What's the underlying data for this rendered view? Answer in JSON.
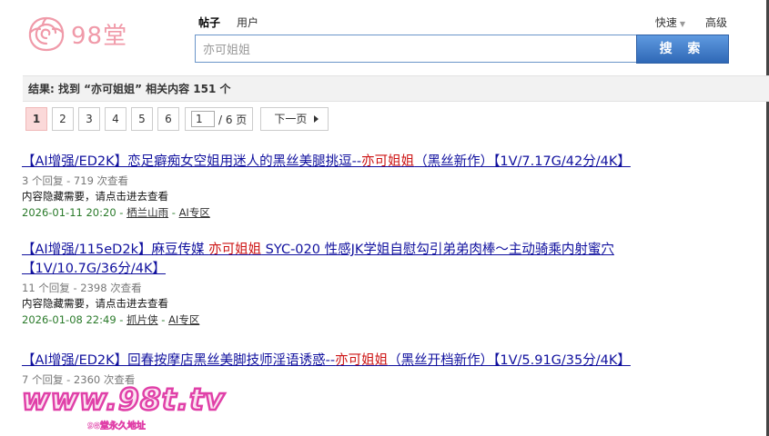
{
  "logo": {
    "text": "98堂"
  },
  "search": {
    "types": [
      "帖子",
      "用户"
    ],
    "active_type": "帖子",
    "query": "亦可姐姐",
    "button_label": "搜 索",
    "quick_label": "快速",
    "advanced_label": "高级"
  },
  "results_summary": {
    "prefix": "结果: 找到 “",
    "keyword": "亦可姐姐",
    "suffix": "” 相关内容 151 个"
  },
  "pager": {
    "pages": [
      "1",
      "2",
      "3",
      "4",
      "5",
      "6"
    ],
    "current": "1",
    "input_value": "1",
    "total_label": "/ 6 页",
    "next_label": "下一页"
  },
  "results": [
    {
      "title_before": "【AI增强/ED2K】恋足癖痴女空姐用迷人的黑丝美腿挑逗--",
      "title_hl": "亦可姐姐",
      "title_after": "（黑丝新作）【1V/7.17G/42分/4K】",
      "stats": "3 个回复 - 719 次查看",
      "snippet": "内容隐藏需要，请点击进去查看",
      "date": "2026-01-11 20:20 - ",
      "author": "栖兰山雨",
      "sep": " - ",
      "forum": "AI专区"
    },
    {
      "title_before": "【AI增强/115eD2k】麻豆传媒 ",
      "title_hl": "亦可姐姐",
      "title_after": " SYC-020 性感JK学姐自慰勾引弟弟肉棒～主动骑乘内射蜜穴【1V/10.7G/36分/4K】",
      "stats": "11 个回复 - 2398 次查看",
      "snippet": "内容隐藏需要，请点击进去查看",
      "date": "2026-01-08 22:49 - ",
      "author": "抓片侠",
      "sep": " - ",
      "forum": "AI专区"
    },
    {
      "title_before": "【AI增强/ED2K】回春按摩店黑丝美脚技师淫语诱惑--",
      "title_hl": "亦可姐姐",
      "title_after": "（黑丝开档新作）【1V/5.91G/35分/4K】",
      "stats": "7 个回复 - 2360 次查看",
      "snippet": "",
      "date": "",
      "author": "",
      "sep": "",
      "forum": ""
    }
  ],
  "watermark": {
    "text": "www.98t.tv",
    "sub": "98堂永久地址"
  },
  "colors": {
    "link": "#10109e",
    "highlight": "#cc1111",
    "search_button": "#3f7ccb",
    "current_page_bg": "#fbd9d9",
    "logo": "#f09aa9",
    "watermark_stroke": "#e040a8"
  }
}
